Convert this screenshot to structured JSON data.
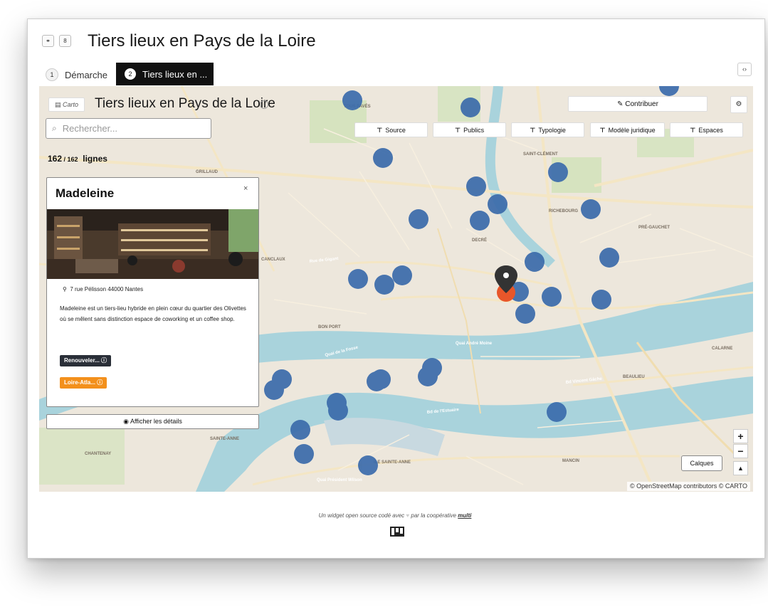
{
  "header": {
    "title": "Tiers lieux en Pays de la Loire",
    "btn_link_icon": "⚭",
    "btn_lock_icon": "8"
  },
  "tabs": [
    {
      "num": "1",
      "label": "Démarche"
    },
    {
      "num": "2",
      "label": "Tiers lieux en ..."
    }
  ],
  "map_ui": {
    "carto_tag": "Carto",
    "title": "Tiers lieux en Pays de la Loire",
    "search_placeholder": "Rechercher...",
    "count_current": "162",
    "count_total": "162",
    "count_unit": "lignes",
    "contribute_label": "Contribuer",
    "filters": [
      "Source",
      "Publics",
      "Typologie",
      "Modèle juridique",
      "Espaces"
    ],
    "zoom_in": "+",
    "zoom_out": "−",
    "calques_label": "Calques",
    "attribution": "© OpenStreetMap contributors © CARTO"
  },
  "card": {
    "title": "Madeleine",
    "address": "7 rue Pélisson 44000 Nantes",
    "description": "Madeleine est un tiers-lieu hybride en plein cœur du quartier des Olivettes où se mêlent sans distinction espace de coworking et un coffee shop.",
    "badges": [
      {
        "label": "Renouveler...",
        "color": "#2a2f38"
      },
      {
        "label": "Loire-Atla...",
        "color": "#f3901c"
      }
    ]
  },
  "details_button": "Afficher les détails",
  "map_labels": {
    "l1": "SAINT-CLÉMENT",
    "l2": "RICHEBOURG",
    "l3": "DECRÉ",
    "l4": "PRÉ-GAUCHET",
    "l5": "BON PORT",
    "l6": "BEAULIEU",
    "l7": "CALARNE",
    "l8": "MANCIN",
    "l9": "SAINTE-ANNE",
    "l10": "CHANTENAY",
    "l11": "GRILLAUD",
    "l12": "CANCLAUX",
    "l13": "ÎLE SAINTE-ANNE",
    "l14": "Quai André Moine",
    "l15": "Quai de la Fosse",
    "l16": "Bd Vincent Gâche",
    "l17": "Quai Président Wilson",
    "l18": "TOUS PAVÉS",
    "l19": "Rue de Gigant",
    "l20": "Bd de l'Estuaire"
  },
  "footer": {
    "text_before": "Un widget open source codé avec",
    "text_after": "par la coopérative",
    "brand": "multi"
  },
  "colors": {
    "marker": "#3b6bab",
    "selected_marker": "#e8562a",
    "badge_dark": "#2a2f38",
    "badge_orange": "#f3901c",
    "water": "#a9d3dc",
    "park": "#cfe2b8"
  },
  "icons": [
    "search-icon",
    "pencil-icon",
    "gear-icon",
    "filter-icon",
    "location-pin-icon",
    "info-icon",
    "close-icon",
    "eye-icon",
    "north-arrow-icon"
  ]
}
